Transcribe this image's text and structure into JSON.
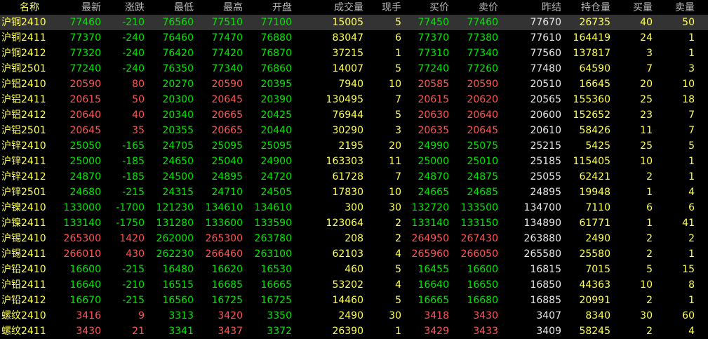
{
  "colors": {
    "up": "#ff5454",
    "down": "#00e600",
    "flat": "#e8e8e8",
    "name": "#ffff54",
    "volume": "#ffff54",
    "header": "#b8b8b8",
    "background": "#000000",
    "selected_row": "#333333"
  },
  "header": [
    "名称",
    "最新",
    "涨跌",
    "最低",
    "最高",
    "开盘",
    "成交量",
    "现手",
    "买价",
    "卖价",
    "昨结",
    "持仓量",
    "买量",
    "卖量"
  ],
  "rows": [
    {
      "name": "沪铜2410",
      "last": "77460",
      "chg": "-210",
      "low": "76560",
      "high": "77510",
      "open": "77100",
      "vol": "15005",
      "cur": "5",
      "bid": "77450",
      "ask": "77460",
      "prev": "77670",
      "oi": "26735",
      "bidv": "40",
      "askv": "50"
    },
    {
      "name": "沪铜2411",
      "last": "77370",
      "chg": "-240",
      "low": "76460",
      "high": "77470",
      "open": "76880",
      "vol": "83047",
      "cur": "6",
      "bid": "77370",
      "ask": "77380",
      "prev": "77610",
      "oi": "164419",
      "bidv": "24",
      "askv": "1"
    },
    {
      "name": "沪铜2412",
      "last": "77320",
      "chg": "-240",
      "low": "76420",
      "high": "77420",
      "open": "76870",
      "vol": "37215",
      "cur": "1",
      "bid": "77310",
      "ask": "77340",
      "prev": "77560",
      "oi": "137817",
      "bidv": "3",
      "askv": "1"
    },
    {
      "name": "沪铜2501",
      "last": "77240",
      "chg": "-240",
      "low": "76350",
      "high": "77340",
      "open": "76860",
      "vol": "14007",
      "cur": "5",
      "bid": "77240",
      "ask": "77260",
      "prev": "77480",
      "oi": "64590",
      "bidv": "7",
      "askv": "3"
    },
    {
      "name": "沪铝2410",
      "last": "20590",
      "chg": "80",
      "low": "20270",
      "high": "20590",
      "open": "20395",
      "vol": "7940",
      "cur": "10",
      "bid": "20585",
      "ask": "20590",
      "prev": "20510",
      "oi": "16645",
      "bidv": "20",
      "askv": "10"
    },
    {
      "name": "沪铝2411",
      "last": "20615",
      "chg": "50",
      "low": "20300",
      "high": "20645",
      "open": "20390",
      "vol": "130495",
      "cur": "7",
      "bid": "20615",
      "ask": "20620",
      "prev": "20565",
      "oi": "155360",
      "bidv": "25",
      "askv": "18"
    },
    {
      "name": "沪铝2412",
      "last": "20640",
      "chg": "40",
      "low": "20340",
      "high": "20665",
      "open": "20425",
      "vol": "76944",
      "cur": "5",
      "bid": "20630",
      "ask": "20640",
      "prev": "20600",
      "oi": "152652",
      "bidv": "23",
      "askv": "7"
    },
    {
      "name": "沪铝2501",
      "last": "20645",
      "chg": "35",
      "low": "20355",
      "high": "20665",
      "open": "20440",
      "vol": "30290",
      "cur": "3",
      "bid": "20635",
      "ask": "20645",
      "prev": "20610",
      "oi": "58426",
      "bidv": "11",
      "askv": "7"
    },
    {
      "name": "沪锌2410",
      "last": "25050",
      "chg": "-165",
      "low": "24705",
      "high": "25095",
      "open": "25095",
      "vol": "2195",
      "cur": "20",
      "bid": "24990",
      "ask": "25075",
      "prev": "25215",
      "oi": "5425",
      "bidv": "25",
      "askv": "5"
    },
    {
      "name": "沪锌2411",
      "last": "25000",
      "chg": "-185",
      "low": "24650",
      "high": "25040",
      "open": "24900",
      "vol": "163303",
      "cur": "11",
      "bid": "25000",
      "ask": "25010",
      "prev": "25185",
      "oi": "115405",
      "bidv": "10",
      "askv": "1"
    },
    {
      "name": "沪锌2412",
      "last": "24870",
      "chg": "-185",
      "low": "24500",
      "high": "24895",
      "open": "24720",
      "vol": "61728",
      "cur": "7",
      "bid": "24870",
      "ask": "24875",
      "prev": "25055",
      "oi": "62421",
      "bidv": "2",
      "askv": "1"
    },
    {
      "name": "沪锌2501",
      "last": "24680",
      "chg": "-215",
      "low": "24315",
      "high": "24710",
      "open": "24505",
      "vol": "17830",
      "cur": "10",
      "bid": "24665",
      "ask": "24685",
      "prev": "24895",
      "oi": "19948",
      "bidv": "1",
      "askv": "4"
    },
    {
      "name": "沪镍2410",
      "last": "133000",
      "chg": "-1700",
      "low": "121230",
      "high": "134610",
      "open": "134610",
      "vol": "300",
      "cur": "30",
      "bid": "132720",
      "ask": "133500",
      "prev": "134700",
      "oi": "7110",
      "bidv": "6",
      "askv": "6"
    },
    {
      "name": "沪镍2411",
      "last": "133140",
      "chg": "-1750",
      "low": "131280",
      "high": "133600",
      "open": "133590",
      "vol": "123064",
      "cur": "2",
      "bid": "133140",
      "ask": "133150",
      "prev": "134890",
      "oi": "61771",
      "bidv": "1",
      "askv": "41"
    },
    {
      "name": "沪锡2410",
      "last": "265300",
      "chg": "1420",
      "low": "262000",
      "high": "265300",
      "open": "263780",
      "vol": "208",
      "cur": "2",
      "bid": "264950",
      "ask": "267430",
      "prev": "263880",
      "oi": "2490",
      "bidv": "2",
      "askv": "2"
    },
    {
      "name": "沪锡2411",
      "last": "266010",
      "chg": "430",
      "low": "262230",
      "high": "266460",
      "open": "263100",
      "vol": "62103",
      "cur": "4",
      "bid": "265960",
      "ask": "266050",
      "prev": "265580",
      "oi": "25580",
      "bidv": "2",
      "askv": "1"
    },
    {
      "name": "沪铅2410",
      "last": "16600",
      "chg": "-215",
      "low": "16480",
      "high": "16620",
      "open": "16530",
      "vol": "460",
      "cur": "5",
      "bid": "16455",
      "ask": "16600",
      "prev": "16815",
      "oi": "7015",
      "bidv": "5",
      "askv": "15"
    },
    {
      "name": "沪铅2411",
      "last": "16640",
      "chg": "-210",
      "low": "16515",
      "high": "16685",
      "open": "16665",
      "vol": "53202",
      "cur": "4",
      "bid": "16640",
      "ask": "16650",
      "prev": "16850",
      "oi": "44363",
      "bidv": "10",
      "askv": "8"
    },
    {
      "name": "沪铅2412",
      "last": "16670",
      "chg": "-215",
      "low": "16560",
      "high": "16725",
      "open": "16725",
      "vol": "14460",
      "cur": "5",
      "bid": "16665",
      "ask": "16680",
      "prev": "16885",
      "oi": "20991",
      "bidv": "2",
      "askv": "1"
    },
    {
      "name": "螺纹2410",
      "last": "3416",
      "chg": "9",
      "low": "3313",
      "high": "3420",
      "open": "3350",
      "vol": "2490",
      "cur": "30",
      "bid": "3418",
      "ask": "3430",
      "prev": "3407",
      "oi": "8340",
      "bidv": "30",
      "askv": "60"
    },
    {
      "name": "螺纹2411",
      "last": "3430",
      "chg": "21",
      "low": "3341",
      "high": "3437",
      "open": "3372",
      "vol": "26390",
      "cur": "1",
      "bid": "3429",
      "ask": "3433",
      "prev": "3409",
      "oi": "58245",
      "bidv": "2",
      "askv": "4"
    }
  ]
}
